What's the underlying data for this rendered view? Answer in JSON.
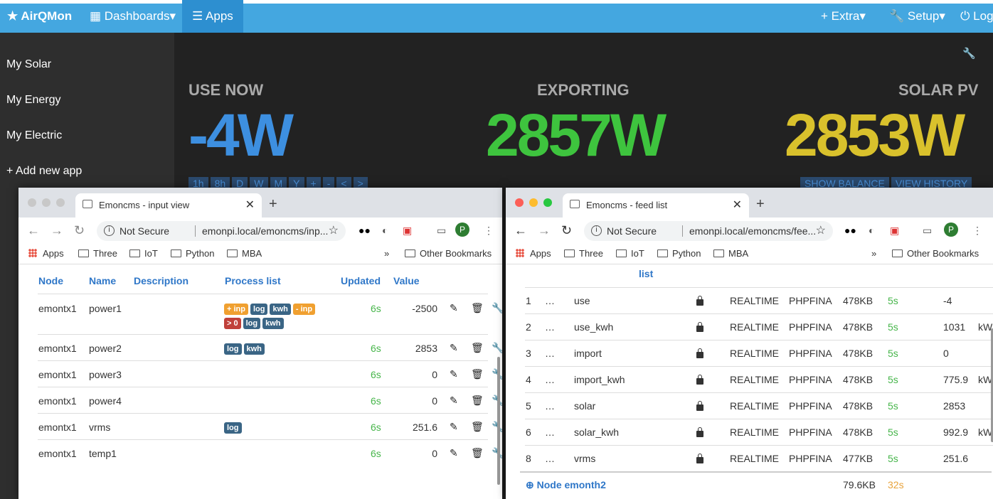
{
  "topnav": {
    "brand": "★ AirQMon",
    "dashboards": "▦ Dashboards▾",
    "apps": "☰ Apps",
    "extra": "+ Extra▾",
    "setup": "Setup▾",
    "logout": "⏻ Log"
  },
  "sidebar": {
    "items": [
      "My Solar",
      "My Energy",
      "My Electric",
      "+ Add new app"
    ]
  },
  "dashboard": {
    "use_now_label": "USE NOW",
    "use_now_value": "-4W",
    "exporting_label": "EXPORTING",
    "exporting_value": "2857W",
    "solar_label": "SOLAR PV",
    "solar_value": "2853W",
    "range_buttons": [
      "1h",
      "8h",
      "D",
      "W",
      "M",
      "Y",
      "+",
      "-",
      "<",
      ">"
    ],
    "show_balance": "SHOW BALANCE",
    "view_history": "VIEW HISTORY"
  },
  "browser_common": {
    "not_secure": "Not Secure",
    "bookmarks": [
      "Apps",
      "Three",
      "IoT",
      "Python",
      "MBA"
    ],
    "other_bookmarks": "Other Bookmarks",
    "more": "»",
    "profile": "P"
  },
  "input_window": {
    "tab_title": "Emoncms - input view",
    "url": "emonpi.local/emoncms/inp...",
    "headers": [
      "Node",
      "Name",
      "Description",
      "Process list",
      "Updated",
      "Value"
    ],
    "rows": [
      {
        "node": "emontx1",
        "name": "power1",
        "updated": "6s",
        "value": "-2500"
      },
      {
        "node": "emontx1",
        "name": "power2",
        "updated": "6s",
        "value": "2853"
      },
      {
        "node": "emontx1",
        "name": "power3",
        "updated": "6s",
        "value": "0"
      },
      {
        "node": "emontx1",
        "name": "power4",
        "updated": "6s",
        "value": "0"
      },
      {
        "node": "emontx1",
        "name": "vrms",
        "updated": "6s",
        "value": "251.6"
      },
      {
        "node": "emontx1",
        "name": "temp1",
        "updated": "6s",
        "value": "0"
      }
    ],
    "process_labels": {
      "power1_a": [
        "+ inp",
        "log",
        "kwh",
        "- inp"
      ],
      "power1_b": [
        "> 0",
        "log",
        "kwh"
      ],
      "power2": [
        "log",
        "kwh"
      ],
      "vrms": [
        "log"
      ]
    }
  },
  "feed_window": {
    "tab_title": "Emoncms - feed list",
    "url": "emonpi.local/emoncms/fee...",
    "list_header": "list",
    "rows": [
      {
        "id": "1",
        "name": "use",
        "engine": "REALTIME",
        "type": "PHPFINA",
        "size": "478KB",
        "updated": "5s",
        "value": "-4",
        "unit": ""
      },
      {
        "id": "2",
        "name": "use_kwh",
        "engine": "REALTIME",
        "type": "PHPFINA",
        "size": "478KB",
        "updated": "5s",
        "value": "1031",
        "unit": "kW"
      },
      {
        "id": "3",
        "name": "import",
        "engine": "REALTIME",
        "type": "PHPFINA",
        "size": "478KB",
        "updated": "5s",
        "value": "0",
        "unit": ""
      },
      {
        "id": "4",
        "name": "import_kwh",
        "engine": "REALTIME",
        "type": "PHPFINA",
        "size": "478KB",
        "updated": "5s",
        "value": "775.9",
        "unit": "kW"
      },
      {
        "id": "5",
        "name": "solar",
        "engine": "REALTIME",
        "type": "PHPFINA",
        "size": "478KB",
        "updated": "5s",
        "value": "2853",
        "unit": ""
      },
      {
        "id": "6",
        "name": "solar_kwh",
        "engine": "REALTIME",
        "type": "PHPFINA",
        "size": "478KB",
        "updated": "5s",
        "value": "992.9",
        "unit": "kW"
      },
      {
        "id": "8",
        "name": "vrms",
        "engine": "REALTIME",
        "type": "PHPFINA",
        "size": "477KB",
        "updated": "5s",
        "value": "251.6",
        "unit": ""
      }
    ],
    "ellipsis": "…",
    "node_group": "Node emonth2",
    "node_group_size": "79.6KB",
    "node_group_updated": "32s"
  }
}
